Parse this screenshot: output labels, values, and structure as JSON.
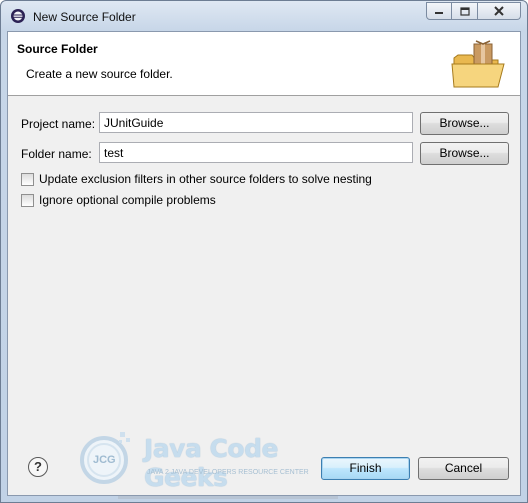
{
  "window": {
    "title": "New Source Folder",
    "controls": {
      "minimize": "minimize-icon",
      "maximize": "maximize-icon",
      "close": "close-icon"
    }
  },
  "header": {
    "title": "Source Folder",
    "description": "Create a new source folder.",
    "icon": "source-folder-package-icon"
  },
  "form": {
    "project_name": {
      "label": "Project name:",
      "value": "JUnitGuide",
      "button": "Browse..."
    },
    "folder_name": {
      "label": "Folder name:",
      "value": "test",
      "button": "Browse..."
    }
  },
  "options": [
    {
      "label": "Update exclusion filters in other source folders to solve nesting",
      "checked": false
    },
    {
      "label": "Ignore optional compile problems",
      "checked": false
    }
  ],
  "footer": {
    "help_label": "?",
    "finish_label": "Finish",
    "cancel_label": "Cancel"
  },
  "watermark": {
    "brand": "Java Code Geeks",
    "tagline": "JAVA 2 JAVA DEVELOPERS RESOURCE CENTER",
    "logo_text": "JCG"
  },
  "colors": {
    "title_bar": "#c7d6e8",
    "dialog_bg": "#f0f0f0",
    "default_button": "#bee6fd"
  }
}
